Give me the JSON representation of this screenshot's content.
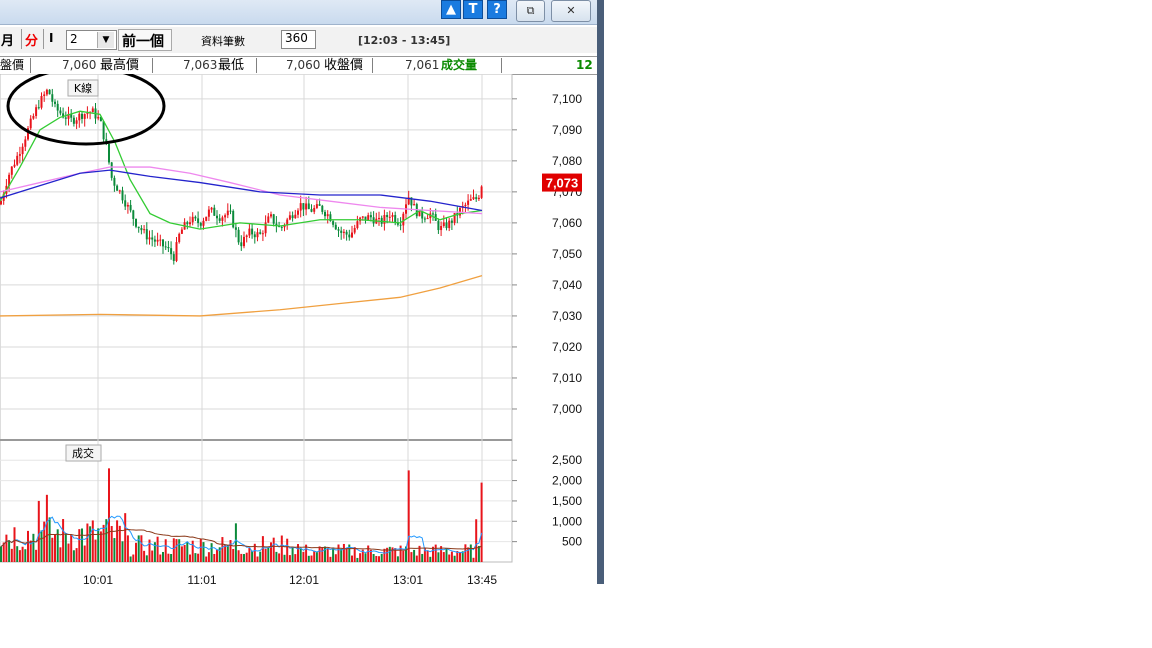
{
  "window": {
    "buttons": {
      "restore_label": "⧉",
      "close_label": "✕",
      "up_glyph": "▲",
      "t_glyph": "T",
      "help_glyph": "?"
    }
  },
  "toolbar": {
    "month_label": "月",
    "minute_label": "分",
    "i_label": "I",
    "period_value": "2",
    "prev_label": "前一個",
    "count_label": "資料筆數",
    "count_value": "360",
    "time_range": "[12:03 - 13:45]"
  },
  "info": {
    "open_label": "盤價",
    "open_value": "7,060",
    "high_label": "最高價",
    "high_value": "7,063",
    "low_label": "最低",
    "low_value": "7,060",
    "close_label": "收盤價",
    "close_value": "7,061",
    "volume_label": "成交量",
    "volume_value": "12"
  },
  "price_panel": {
    "label": "K線"
  },
  "volume_panel": {
    "label": "成交"
  },
  "colors": {
    "up": "#e8141b",
    "down": "#0b8a3a",
    "ma_green": "#33cc33",
    "ma_pink": "#ee88ee",
    "ma_blue": "#2424cc",
    "ma_orange": "#f0a040",
    "vol_ma_blue": "#2299ff",
    "vol_ma_brown": "#8b3a1a",
    "current_price_bg": "#e00000"
  },
  "chart_data": {
    "type": "candlestick",
    "price_axis": {
      "ticks": [
        7000,
        7010,
        7020,
        7030,
        7040,
        7050,
        7060,
        7070,
        7080,
        7090,
        7100
      ],
      "range": [
        6990,
        7108
      ]
    },
    "volume_axis": {
      "ticks": [
        500,
        1000,
        1500,
        2000,
        2500
      ],
      "range": [
        0,
        2800
      ]
    },
    "time_axis": [
      "10:01",
      "11:01",
      "12:01",
      "13:01",
      "13:45"
    ],
    "current_price": "7,073",
    "price_path": [
      [
        0,
        7066
      ],
      [
        8,
        7075
      ],
      [
        18,
        7082
      ],
      [
        28,
        7090
      ],
      [
        38,
        7098
      ],
      [
        48,
        7103
      ],
      [
        55,
        7097
      ],
      [
        62,
        7095
      ],
      [
        72,
        7093
      ],
      [
        82,
        7095
      ],
      [
        92,
        7096
      ],
      [
        100,
        7093
      ],
      [
        106,
        7085
      ],
      [
        112,
        7074
      ],
      [
        120,
        7070
      ],
      [
        128,
        7065
      ],
      [
        136,
        7060
      ],
      [
        146,
        7056
      ],
      [
        156,
        7054
      ],
      [
        166,
        7052
      ],
      [
        174,
        7049
      ],
      [
        180,
        7057
      ],
      [
        190,
        7061
      ],
      [
        200,
        7060
      ],
      [
        210,
        7064
      ],
      [
        220,
        7062
      ],
      [
        230,
        7063
      ],
      [
        240,
        7053
      ],
      [
        250,
        7057
      ],
      [
        260,
        7056
      ],
      [
        270,
        7062
      ],
      [
        280,
        7058
      ],
      [
        290,
        7062
      ],
      [
        300,
        7066
      ],
      [
        310,
        7064
      ],
      [
        320,
        7065
      ],
      [
        330,
        7062
      ],
      [
        340,
        7057
      ],
      [
        350,
        7056
      ],
      [
        360,
        7061
      ],
      [
        370,
        7062
      ],
      [
        380,
        7060
      ],
      [
        390,
        7063
      ],
      [
        400,
        7060
      ],
      [
        408,
        7069
      ],
      [
        414,
        7065
      ],
      [
        420,
        7062
      ],
      [
        430,
        7063
      ],
      [
        440,
        7058
      ],
      [
        450,
        7060
      ],
      [
        460,
        7064
      ],
      [
        470,
        7067
      ],
      [
        478,
        7068
      ],
      [
        482,
        7073
      ]
    ],
    "series": [
      {
        "color_key": "ma_green",
        "points": [
          [
            0,
            7067
          ],
          [
            20,
            7078
          ],
          [
            40,
            7090
          ],
          [
            60,
            7094
          ],
          [
            80,
            7096
          ],
          [
            100,
            7095
          ],
          [
            115,
            7086
          ],
          [
            130,
            7074
          ],
          [
            150,
            7063
          ],
          [
            170,
            7060
          ],
          [
            200,
            7058
          ],
          [
            240,
            7060
          ],
          [
            280,
            7059
          ],
          [
            320,
            7061
          ],
          [
            360,
            7061
          ],
          [
            400,
            7060
          ],
          [
            420,
            7064
          ],
          [
            440,
            7061
          ],
          [
            460,
            7063
          ],
          [
            482,
            7064
          ]
        ]
      },
      {
        "color_key": "ma_pink",
        "points": [
          [
            0,
            7070
          ],
          [
            40,
            7073
          ],
          [
            80,
            7076
          ],
          [
            110,
            7078
          ],
          [
            150,
            7078
          ],
          [
            190,
            7076
          ],
          [
            230,
            7073
          ],
          [
            280,
            7069
          ],
          [
            330,
            7067
          ],
          [
            380,
            7065
          ],
          [
            430,
            7064
          ],
          [
            482,
            7063
          ]
        ]
      },
      {
        "color_key": "ma_blue",
        "points": [
          [
            0,
            7068
          ],
          [
            40,
            7072
          ],
          [
            80,
            7076
          ],
          [
            110,
            7077
          ],
          [
            150,
            7075
          ],
          [
            200,
            7073
          ],
          [
            260,
            7070
          ],
          [
            320,
            7069
          ],
          [
            380,
            7069
          ],
          [
            430,
            7067
          ],
          [
            482,
            7064
          ]
        ]
      },
      {
        "color_key": "ma_orange",
        "points": [
          [
            0,
            7030
          ],
          [
            100,
            7030.5
          ],
          [
            200,
            7030
          ],
          [
            280,
            7032
          ],
          [
            340,
            7034
          ],
          [
            400,
            7036
          ],
          [
            440,
            7039
          ],
          [
            482,
            7043
          ]
        ]
      }
    ],
    "volume_spikes": [
      [
        38,
        1500
      ],
      [
        46,
        1650
      ],
      [
        110,
        2300
      ],
      [
        125,
        1200
      ],
      [
        236,
        950
      ],
      [
        408,
        2250
      ],
      [
        476,
        1050
      ],
      [
        482,
        1950
      ]
    ]
  }
}
